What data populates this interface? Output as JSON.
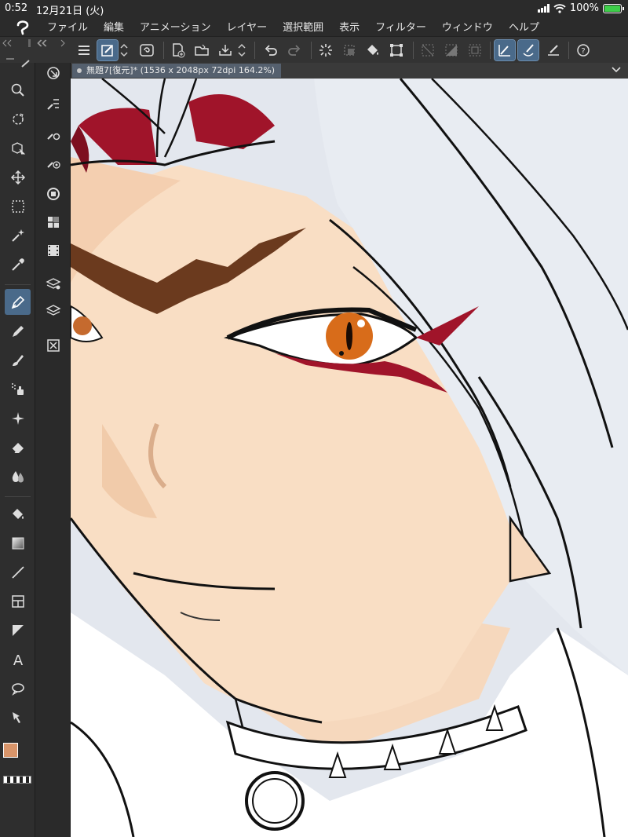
{
  "status": {
    "time": "0:52",
    "date": "12月21日 (火)",
    "battery": "100%",
    "icons": [
      "cellular-signal-icon",
      "wifi-icon",
      "battery-charging-icon"
    ]
  },
  "menu": {
    "items": [
      "ファイル",
      "編集",
      "アニメーション",
      "レイヤー",
      "選択範囲",
      "表示",
      "フィルター",
      "ウィンドウ",
      "ヘルプ"
    ]
  },
  "toolbar": {
    "icons": [
      "hamburger-menu-icon",
      "edit-mode-icon",
      "scroll-icon",
      "new-document-icon",
      "open-file-icon",
      "save-file-icon",
      "undo-icon",
      "redo-icon",
      "clear-selection-icon",
      "fill-icon",
      "transform-icon",
      "correction-icon",
      "help-icon"
    ]
  },
  "document": {
    "tab_title": "無題7[復元]* (1536 x 2048px 72dpi 164.2%)"
  },
  "tools": {
    "main": [
      "zoom-icon",
      "rotate-icon",
      "object-icon",
      "move-icon",
      "selection-icon",
      "auto-select-icon",
      "eyedropper-icon",
      "pen-icon",
      "pencil-icon",
      "brush-icon",
      "airbrush-icon",
      "decoration-icon",
      "eraser-icon",
      "blend-icon",
      "fill-icon",
      "gradient-icon",
      "figure-icon",
      "frame-icon",
      "ruler-icon",
      "text-icon",
      "balloon-icon",
      "correct-line-icon"
    ],
    "sub": [
      "navigator-icon",
      "tool-property-icon",
      "sub-tool-detail-icon",
      "brush-size-icon",
      "color-circle-icon",
      "color-set-icon",
      "animation-icon",
      "layer-property-icon",
      "layer-icon",
      "material-icon"
    ]
  },
  "colors": {
    "main_color": "#d9956a",
    "sub_color": "#ffffff",
    "accent": "#4a6a8a",
    "hair": "#e8ecf2",
    "skin": "#f9dec4",
    "eye": "#d86c1a",
    "red_accent": "#a0142a",
    "brow": "#6b3a1e"
  }
}
